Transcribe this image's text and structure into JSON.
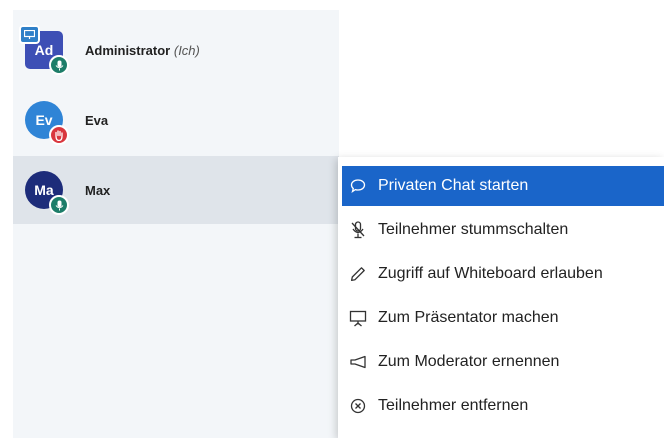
{
  "users": [
    {
      "initials": "Ad",
      "name": "Administrator",
      "suffix": "(Ich)",
      "avatar_color": "#3d4fb5",
      "shape": "square",
      "status": "microphone",
      "status_color": "#1d7d69",
      "presenter": true
    },
    {
      "initials": "Ev",
      "name": "Eva",
      "suffix": "",
      "avatar_color": "#2f84d6",
      "shape": "circle",
      "status": "raised-hand",
      "status_color": "#d9363e",
      "presenter": false
    },
    {
      "initials": "Ma",
      "name": "Max",
      "suffix": "",
      "avatar_color": "#1d2c7a",
      "shape": "circle",
      "status": "microphone",
      "status_color": "#1d7d69",
      "presenter": false,
      "selected": true
    }
  ],
  "context_menu": {
    "items": [
      {
        "label": "Privaten Chat starten",
        "icon": "chat-bubble-icon",
        "active": true
      },
      {
        "label": "Teilnehmer stummschalten",
        "icon": "microphone-muted-icon"
      },
      {
        "label": "Zugriff auf Whiteboard erlauben",
        "icon": "pencil-icon"
      },
      {
        "label": "Zum Präsentator machen",
        "icon": "presentation-screen-icon"
      },
      {
        "label": "Zum Moderator ernennen",
        "icon": "megaphone-icon"
      },
      {
        "label": "Teilnehmer entfernen",
        "icon": "remove-circle-icon"
      }
    ]
  },
  "colors": {
    "accent": "#1a65c9",
    "sidebar_bg": "#f3f6f9",
    "selected_row": "#dfe4ea"
  }
}
